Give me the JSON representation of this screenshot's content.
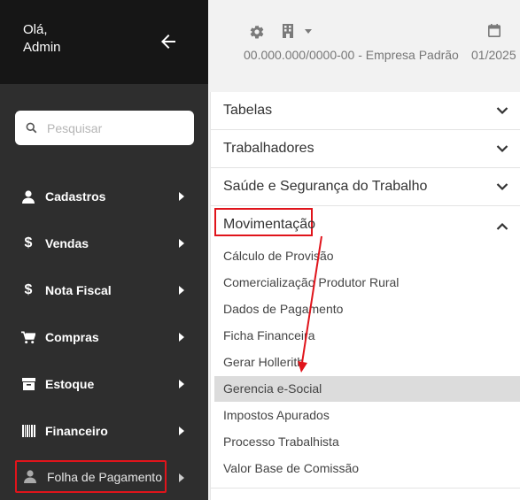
{
  "sidebar": {
    "greeting_line1": "Olá,",
    "greeting_line2": "Admin",
    "search_placeholder": "Pesquisar",
    "items": [
      {
        "label": "Cadastros",
        "icon": "person-icon"
      },
      {
        "label": "Vendas",
        "icon": "dollar-icon"
      },
      {
        "label": "Nota Fiscal",
        "icon": "dollar-icon"
      },
      {
        "label": "Compras",
        "icon": "cart-icon"
      },
      {
        "label": "Estoque",
        "icon": "archive-box-icon"
      },
      {
        "label": "Financeiro",
        "icon": "barcode-icon"
      },
      {
        "label": "Folha de Pagamento",
        "icon": "person-icon"
      }
    ]
  },
  "header": {
    "company": "00.000.000/0000-00 - Empresa Padrão",
    "period": "01/2025"
  },
  "panel": {
    "sections": [
      "Tabelas",
      "Trabalhadores",
      "Saúde e Segurança do Trabalho"
    ],
    "expanded_section": "Movimentação",
    "sub_items": [
      "Cálculo de Provisão",
      "Comercialização Produtor Rural",
      "Dados de Pagamento",
      "Ficha Financeira",
      "Gerar Hollerith",
      "Gerencia e-Social",
      "Impostos Apurados",
      "Processo Trabalhista",
      "Valor Base de Comissão"
    ],
    "active_sub_item": "Gerencia e-Social"
  },
  "colors": {
    "highlight": "#e0141b",
    "sidebar_bg": "#2e2e2e",
    "sidebar_top_bg": "#161616"
  }
}
